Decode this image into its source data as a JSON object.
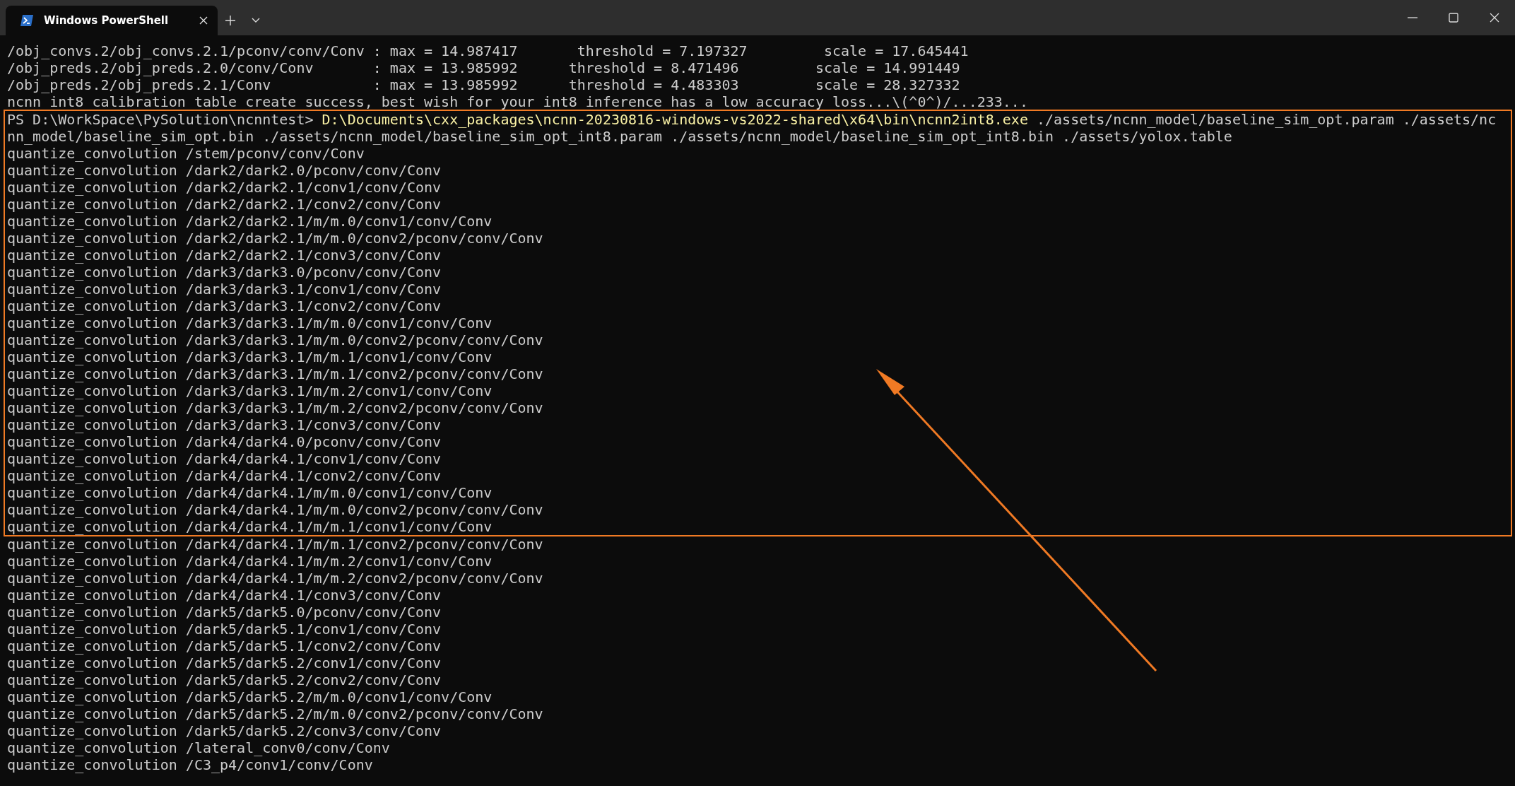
{
  "tabs": [
    {
      "title": "Windows PowerShell",
      "selected": true
    }
  ],
  "output_lines": [
    "/obj_convs.2/obj_convs.2.1/pconv/conv/Conv : max = 14.987417       threshold = 7.197327         scale = 17.645441",
    "/obj_preds.2/obj_preds.2.0/conv/Conv       : max = 13.985992      threshold = 8.471496         scale = 14.991449",
    "/obj_preds.2/obj_preds.2.1/Conv            : max = 13.985992      threshold = 4.483303         scale = 28.327332",
    "ncnn int8 calibration table create success, best wish for your int8 inference has a low accuracy loss...\\(^0^)/...233..."
  ],
  "highlighted": {
    "prompt": "PS D:\\WorkSpace\\PySolution\\ncnntest> ",
    "command": "D:\\Documents\\cxx_packages\\ncnn-20230816-windows-vs2022-shared\\x64\\bin\\ncnn2int8.exe",
    "arguments": " ./assets/ncnn_model/baseline_sim_opt.param ./assets/nc",
    "continuation": "nn_model/baseline_sim_opt.bin ./assets/ncnn_model/baseline_sim_opt_int8.param ./assets/ncnn_model/baseline_sim_opt_int8.bin ./assets/yolox.table",
    "lines": [
      "quantize_convolution /stem/pconv/conv/Conv",
      "quantize_convolution /dark2/dark2.0/pconv/conv/Conv",
      "quantize_convolution /dark2/dark2.1/conv1/conv/Conv",
      "quantize_convolution /dark2/dark2.1/conv2/conv/Conv",
      "quantize_convolution /dark2/dark2.1/m/m.0/conv1/conv/Conv",
      "quantize_convolution /dark2/dark2.1/m/m.0/conv2/pconv/conv/Conv",
      "quantize_convolution /dark2/dark2.1/conv3/conv/Conv",
      "quantize_convolution /dark3/dark3.0/pconv/conv/Conv",
      "quantize_convolution /dark3/dark3.1/conv1/conv/Conv",
      "quantize_convolution /dark3/dark3.1/conv2/conv/Conv",
      "quantize_convolution /dark3/dark3.1/m/m.0/conv1/conv/Conv",
      "quantize_convolution /dark3/dark3.1/m/m.0/conv2/pconv/conv/Conv",
      "quantize_convolution /dark3/dark3.1/m/m.1/conv1/conv/Conv",
      "quantize_convolution /dark3/dark3.1/m/m.1/conv2/pconv/conv/Conv",
      "quantize_convolution /dark3/dark3.1/m/m.2/conv1/conv/Conv",
      "quantize_convolution /dark3/dark3.1/m/m.2/conv2/pconv/conv/Conv",
      "quantize_convolution /dark3/dark3.1/conv3/conv/Conv",
      "quantize_convolution /dark4/dark4.0/pconv/conv/Conv",
      "quantize_convolution /dark4/dark4.1/conv1/conv/Conv",
      "quantize_convolution /dark4/dark4.1/conv2/conv/Conv",
      "quantize_convolution /dark4/dark4.1/m/m.0/conv1/conv/Conv",
      "quantize_convolution /dark4/dark4.1/m/m.0/conv2/pconv/conv/Conv",
      "quantize_convolution /dark4/dark4.1/m/m.1/conv1/conv/Conv"
    ]
  },
  "following_lines": [
    "quantize_convolution /dark4/dark4.1/m/m.1/conv2/pconv/conv/Conv",
    "quantize_convolution /dark4/dark4.1/m/m.2/conv1/conv/Conv",
    "quantize_convolution /dark4/dark4.1/m/m.2/conv2/pconv/conv/Conv",
    "quantize_convolution /dark4/dark4.1/conv3/conv/Conv",
    "quantize_convolution /dark5/dark5.0/pconv/conv/Conv",
    "quantize_convolution /dark5/dark5.1/conv1/conv/Conv",
    "quantize_convolution /dark5/dark5.1/conv2/conv/Conv",
    "quantize_convolution /dark5/dark5.2/conv1/conv/Conv",
    "quantize_convolution /dark5/dark5.2/conv2/conv/Conv",
    "quantize_convolution /dark5/dark5.2/m/m.0/conv1/conv/Conv",
    "quantize_convolution /dark5/dark5.2/m/m.0/conv2/pconv/conv/Conv",
    "quantize_convolution /dark5/dark5.2/conv3/conv/Conv",
    "quantize_convolution /lateral_conv0/conv/Conv",
    "quantize_convolution /C3_p4/conv1/conv/Conv"
  ]
}
